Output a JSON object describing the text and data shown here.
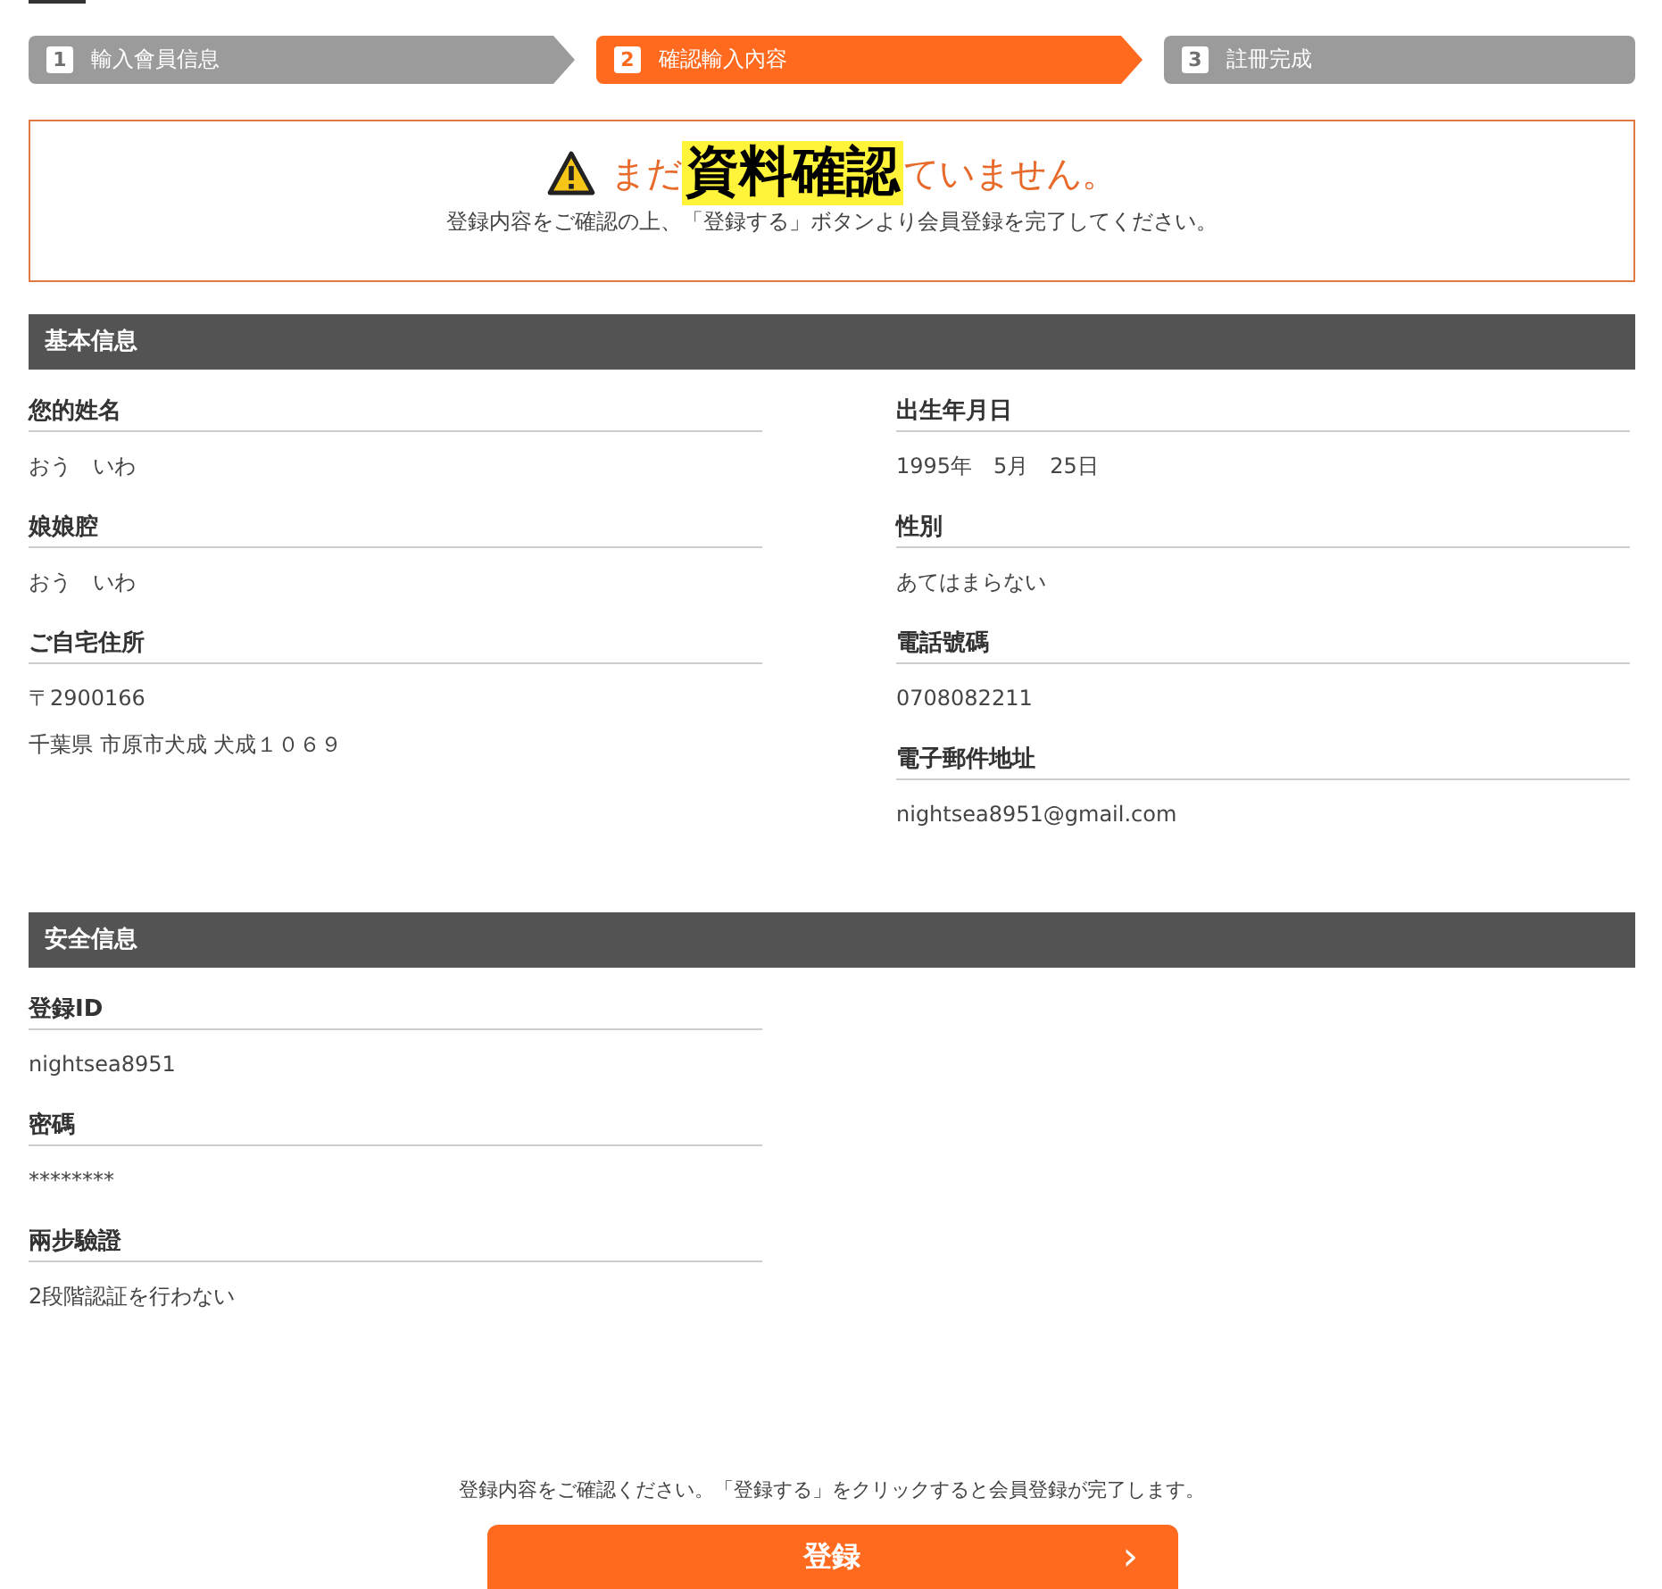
{
  "steps": [
    {
      "number": "1",
      "label": "輸入會員信息",
      "selected": false
    },
    {
      "number": "2",
      "label": "確認輸入內容",
      "selected": true
    },
    {
      "number": "3",
      "label": "註冊完成",
      "selected": false
    }
  ],
  "notice": {
    "heading_start": "まだ",
    "overlay_label": "資料確認",
    "heading_end": "ていません。",
    "message": "登録内容をご確認の上、「登録する」ボタンより会員登録を完了してください。"
  },
  "sections": [
    {
      "title": "基本信息",
      "columns": [
        [
          {
            "label": "您的姓名",
            "values": [
              "おう　いわ"
            ]
          },
          {
            "label": "娘娘腔",
            "values": [
              "おう　いわ"
            ]
          },
          {
            "label": "ご自宅住所",
            "values": [
              "〒2900166",
              "千葉県 市原市犬成 犬成１０６９"
            ]
          }
        ],
        [
          {
            "label": "出生年月日",
            "values": [
              "1995年　5月　25日"
            ]
          },
          {
            "label": "性別",
            "values": [
              "あてはまらない"
            ]
          },
          {
            "label": "電話號碼",
            "values": [
              "0708082211"
            ]
          },
          {
            "label": "電子郵件地址",
            "values": [
              "nightsea8951@gmail.com"
            ]
          }
        ]
      ]
    },
    {
      "title": "安全信息",
      "columns": [
        [
          {
            "label": "登録ID",
            "values": [
              "nightsea8951"
            ]
          },
          {
            "label": "密碼",
            "values": [
              "********"
            ]
          },
          {
            "label": "兩步驗證",
            "values": [
              "2段階認証を行わない"
            ]
          }
        ]
      ]
    }
  ],
  "footer": {
    "note": "登録内容をご確認ください。「登録する」をクリックすると会員登録が完了します。",
    "button": "登録",
    "button_icon": "›"
  }
}
